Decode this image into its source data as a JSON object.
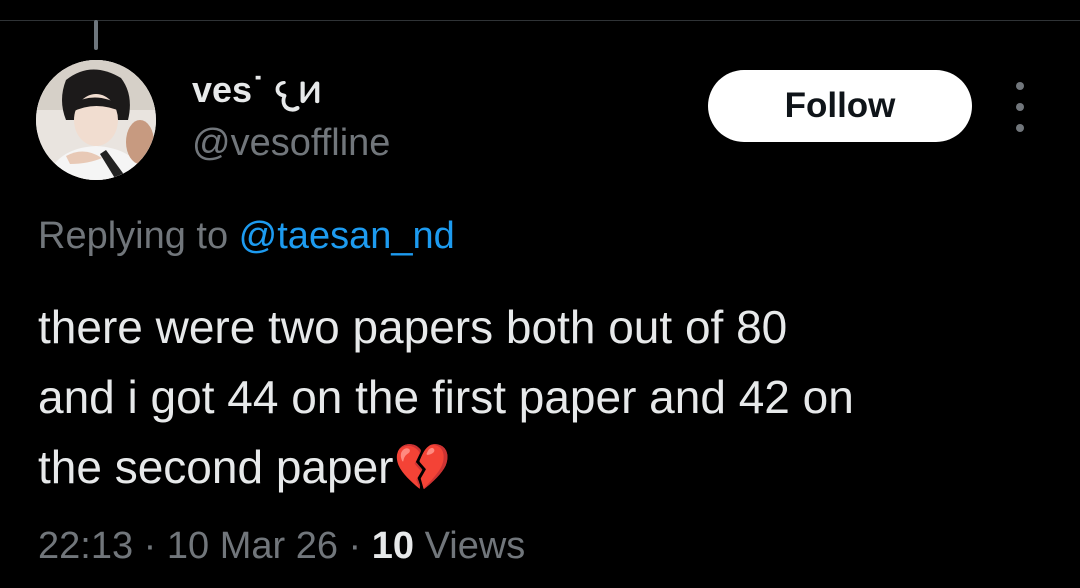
{
  "post": {
    "author": {
      "display_name": "ves˙ 𐔌𐔍",
      "handle": "@vesoffline"
    },
    "follow_label": "Follow",
    "more_icon": "more-vertical-icon",
    "reply": {
      "prefix": "Replying to ",
      "mention": "@taesan_nd"
    },
    "text": "there were two papers both out of 80\nand i got 44 on the first paper and 42 on\nthe second paper💔",
    "meta": {
      "time": "22:13",
      "separator_1": " · ",
      "date": "10 Mar 26",
      "separator_2": " · ",
      "views_count": "10",
      "views_label": " Views"
    }
  },
  "colors": {
    "background": "#000000",
    "text_primary": "#e7e9ea",
    "text_secondary": "#71767b",
    "link": "#1d9bf0",
    "follow_bg": "#ffffff"
  }
}
